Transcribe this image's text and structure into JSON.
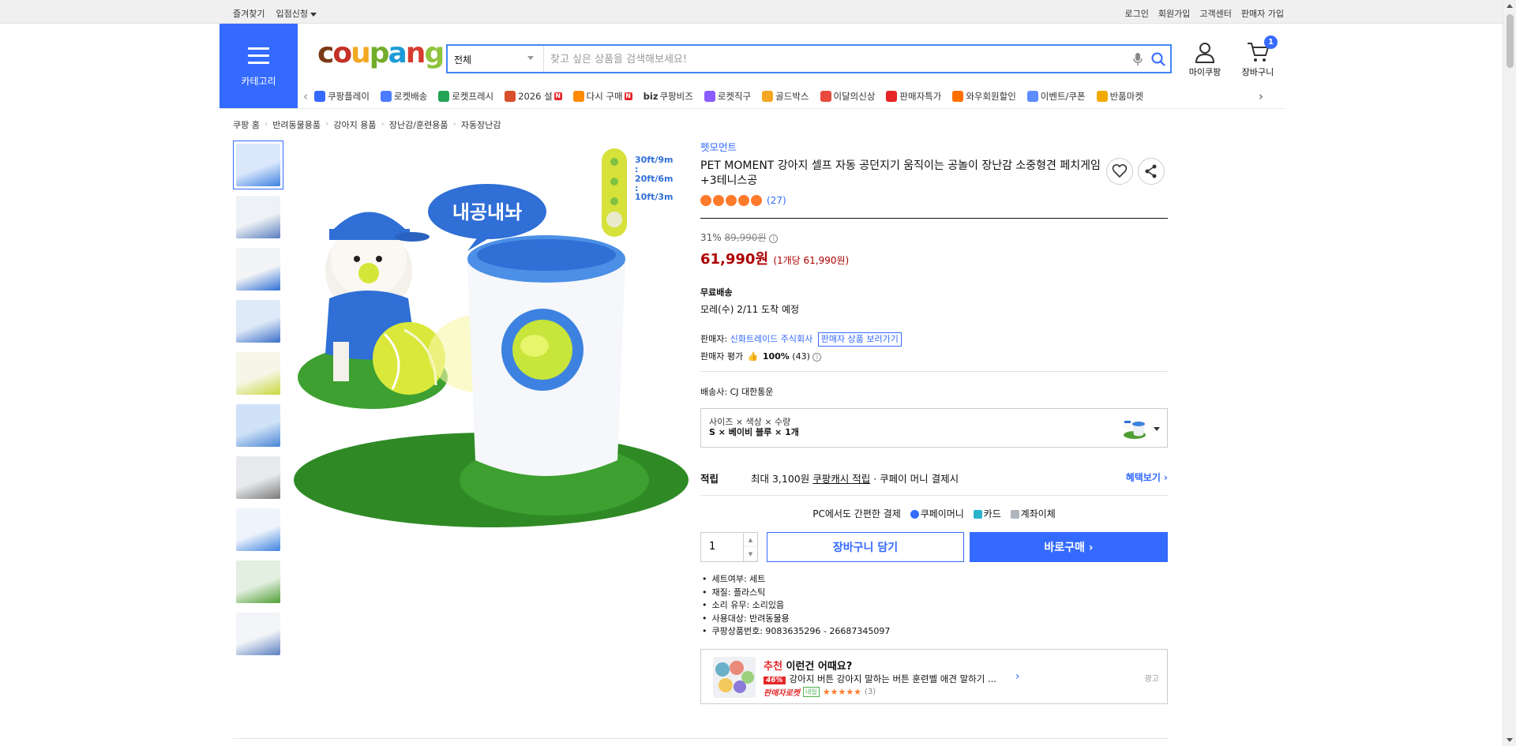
{
  "topbar": {
    "favorites": "즐겨찾기",
    "partner": "입점신청",
    "login": "로그인",
    "signup": "회원가입",
    "customer_center": "고객센터",
    "seller_signup": "판매자 가입"
  },
  "category_button": {
    "label": "카테고리"
  },
  "logo": {
    "text": "coupang"
  },
  "search": {
    "category": "전체",
    "placeholder": "찾고 싶은 상품을 검색해보세요!"
  },
  "header_icons": {
    "my_coupang": "마이쿠팡",
    "cart": "장바구니",
    "cart_count": "1"
  },
  "category_nav": [
    {
      "label": "쿠팡플레이",
      "color": "#346aff"
    },
    {
      "label": "로켓배송",
      "color": "#4a7bff"
    },
    {
      "label": "로켓프레시",
      "color": "#23a455"
    },
    {
      "label": "2026 설",
      "color": "#d94f2b",
      "new": true
    },
    {
      "label": "다시 구매",
      "color": "#ff8a00",
      "new": true
    },
    {
      "label": "쿠팡비즈",
      "color": "#333333",
      "prefix": "biz"
    },
    {
      "label": "로켓직구",
      "color": "#8a5cff"
    },
    {
      "label": "골드박스",
      "color": "#f5a623"
    },
    {
      "label": "이달의신상",
      "color": "#e84a3c"
    },
    {
      "label": "판매자특가",
      "color": "#e52528"
    },
    {
      "label": "와우회원할인",
      "color": "#ff6f00"
    },
    {
      "label": "이벤트/쿠폰",
      "color": "#5d8cff"
    },
    {
      "label": "반품마켓",
      "color": "#f2a900"
    }
  ],
  "new_badge": "N",
  "breadcrumb": [
    "쿠팡 홈",
    "반려동물용품",
    "강아지 용품",
    "장난감/훈련용품",
    "자동장난감"
  ],
  "product": {
    "brand": "펫모먼트",
    "title": "PET MOMENT 강아지 셀프 자동 공던지기 움직이는 공놀이 장난감 소중형견 페치게임+3테니스공",
    "rating_count": "(27)",
    "discount": "31%",
    "original_price": "89,990원",
    "price": "61,990원",
    "unit_price": "(1개당 61,990원)",
    "shipping_label": "무료배송",
    "delivery": "모레(수) 2/11 도착 예정",
    "seller_label": "판매자:",
    "seller_name": "신화트레이드 주식회사",
    "seller_products_button": "판매자 상품 보러가기",
    "seller_rating_label": "판매자 평가",
    "seller_rating": "100%",
    "seller_rating_count": "(43)",
    "courier_label": "배송사:",
    "courier": "CJ 대한통운",
    "option_header": "사이즈 × 색상 × 수량",
    "option_value": "S × 베이비 블루 × 1개",
    "points_label": "적립",
    "points_text": "최대 3,100원",
    "points_cash": "쿠팡캐시 적립",
    "points_tail": "· 쿠페이 머니 결제시",
    "benefit_link": "혜택보기 ›",
    "pc_pay": "PC에서도 간편한 결제",
    "pay_coupay": "쿠페이머니",
    "pay_card": "카드",
    "pay_transfer": "계좌이체",
    "quantity": "1",
    "add_cart": "장바구니 담기",
    "buy_now": "바로구매 ›",
    "attributes": [
      "세트여부: 세트",
      "재질: 플라스틱",
      "소리 유무: 소리있음",
      "사용대상: 반려동물용",
      "쿠팡상품번호: 9083635296 - 26687345097"
    ]
  },
  "image_overlay": {
    "speech": "내공내놔",
    "distances": [
      "30ft/9m",
      ":",
      "20ft/6m",
      ":",
      "10ft/3m"
    ]
  },
  "recommendation": {
    "highlight": "추천",
    "title_rest": " 이런건 어때요?",
    "discount": "46%",
    "name": "강아지 버튼 강아지 말하는 버튼 훈련벨 애견 말하기 ...",
    "badge": "판매자로켓",
    "badge2": "내일",
    "count": "(3)",
    "ad": "광고"
  },
  "colors": {
    "accent": "#346aff",
    "price": "#ae0000",
    "star": "#ff7a2a"
  }
}
